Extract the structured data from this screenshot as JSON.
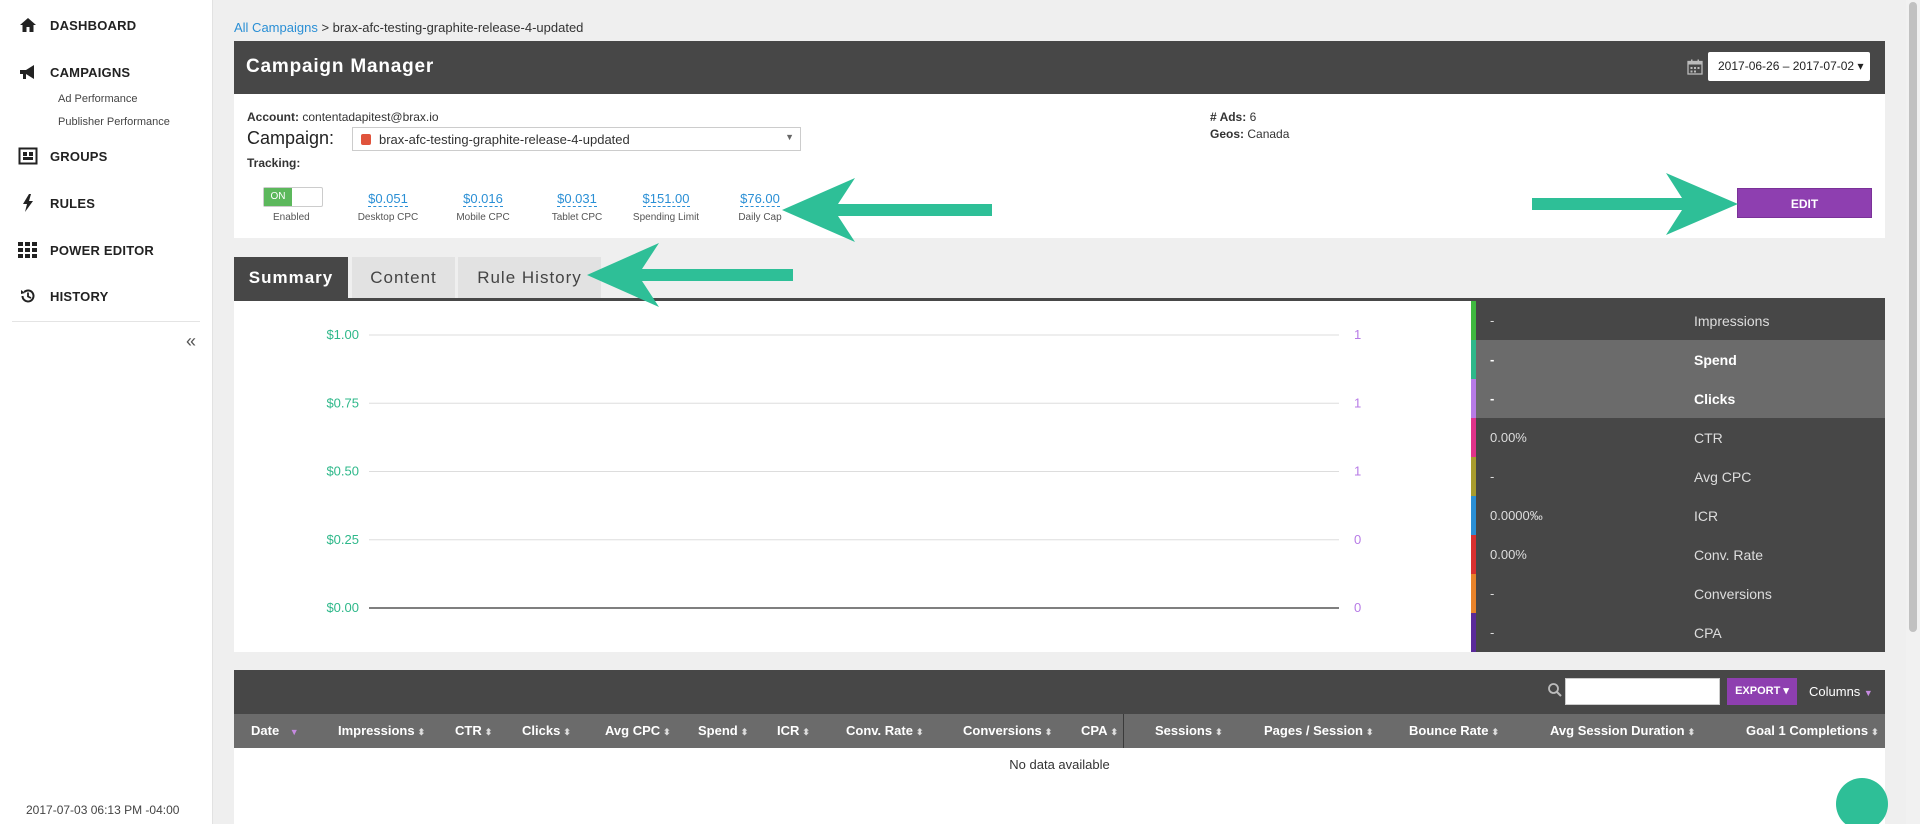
{
  "sidebar": {
    "items": [
      {
        "label": "DASHBOARD",
        "icon": "home-icon"
      },
      {
        "label": "CAMPAIGNS",
        "icon": "megaphone-icon"
      },
      {
        "label": "GROUPS",
        "icon": "groups-icon"
      },
      {
        "label": "RULES",
        "icon": "lightning-icon"
      },
      {
        "label": "POWER EDITOR",
        "icon": "grid-icon"
      },
      {
        "label": "HISTORY",
        "icon": "history-icon"
      }
    ],
    "sub_items": [
      "Ad Performance",
      "Publisher Performance"
    ],
    "collapse_label": "«",
    "timestamp": "2017-07-03 06:13 PM -04:00"
  },
  "breadcrumb": {
    "root": "All Campaigns",
    "separator": " > ",
    "current": "brax-afc-testing-graphite-release-4-updated"
  },
  "header": {
    "title": "Campaign Manager",
    "date_range": "2017-06-26 – 2017-07-02 ▾"
  },
  "info": {
    "account_label": "Account:",
    "account_value": "contentadapitest@brax.io",
    "campaign_label": "Campaign:",
    "campaign_value": "brax-afc-testing-graphite-release-4-updated",
    "tracking_label": "Tracking:",
    "ads_label": "# Ads:",
    "ads_value": "6",
    "geos_label": "Geos:",
    "geos_value": "Canada",
    "toggle_label": "ON",
    "toggle_caption": "Enabled",
    "metrics": [
      {
        "value": "$0.051",
        "caption": "Desktop CPC"
      },
      {
        "value": "$0.016",
        "caption": "Mobile CPC"
      },
      {
        "value": "$0.031",
        "caption": "Tablet CPC"
      },
      {
        "value": "$151.00",
        "caption": "Spending Limit"
      },
      {
        "value": "$76.00",
        "caption": "Daily Cap"
      }
    ],
    "edit_label": "EDIT"
  },
  "tabs": [
    {
      "label": "Summary",
      "active": true
    },
    {
      "label": "Content",
      "active": false
    },
    {
      "label": "Rule History",
      "active": false
    }
  ],
  "chart_data": {
    "type": "line",
    "title": "",
    "xlabel": "",
    "ylabel": "",
    "left_axis": {
      "ticks": [
        "$1.00",
        "$0.75",
        "$0.50",
        "$0.25",
        "$0.00"
      ],
      "ylim": [
        0,
        1
      ],
      "color": "#2eb88a"
    },
    "right_axis": {
      "ticks": [
        "1",
        "1",
        "1",
        "0",
        "0"
      ],
      "color": "#b77be6"
    },
    "series": [],
    "grid": true
  },
  "summary_metrics": [
    {
      "value": "-",
      "name": "Impressions",
      "color": "#3fb93f",
      "active": false
    },
    {
      "value": "-",
      "name": "Spend",
      "color": "#2eb88a",
      "active": true
    },
    {
      "value": "-",
      "name": "Clicks",
      "color": "#b77be6",
      "active": true
    },
    {
      "value": "0.00%",
      "name": "CTR",
      "color": "#e0338a",
      "active": false
    },
    {
      "value": "-",
      "name": "Avg CPC",
      "color": "#a89c2e",
      "active": false
    },
    {
      "value": "0.0000‰",
      "name": "ICR",
      "color": "#2a8fd5",
      "active": false
    },
    {
      "value": "0.00%",
      "name": "Conv. Rate",
      "color": "#d9302f",
      "active": false
    },
    {
      "value": "-",
      "name": "Conversions",
      "color": "#e8832a",
      "active": false
    },
    {
      "value": "-",
      "name": "CPA",
      "color": "#5a2a9a",
      "active": false
    }
  ],
  "table": {
    "search_value": "",
    "export_label": "EXPORT ▾",
    "columns_label": "Columns",
    "headers": [
      "Date",
      "Impressions",
      "CTR",
      "Clicks",
      "Avg CPC",
      "Spend",
      "ICR",
      "Conv. Rate",
      "Conversions",
      "CPA",
      "Sessions",
      "Pages / Session",
      "Bounce Rate",
      "Avg Session Duration",
      "Goal 1 Completions"
    ],
    "empty_text": "No data available"
  },
  "colors": {
    "accent": "#8e3fb0",
    "arrow": "#2ebf97",
    "link": "#2a8fd5",
    "dark": "#474747"
  }
}
